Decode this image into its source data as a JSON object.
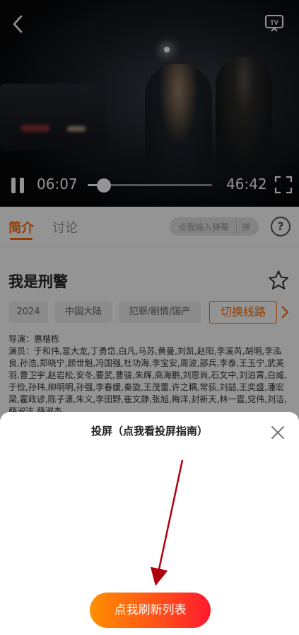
{
  "player": {
    "current_time": "06:07",
    "total_time": "46:42",
    "progress_fraction": 0.13,
    "icons": {
      "back": "chevron-left-icon",
      "cast_tv": "tv-icon",
      "pause": "pause-icon",
      "fullscreen": "fullscreen-icon"
    }
  },
  "tabs": {
    "intro_label": "简介",
    "discuss_label": "讨论",
    "danmu_placeholder": "点我输入弹幕",
    "danmu_send": "弹",
    "help_symbol": "?"
  },
  "show": {
    "title": "我是刑警",
    "tags": [
      "2024",
      "中国大陆",
      "犯罪/剧情/国产"
    ],
    "switch_line_label": "切换线路",
    "director": "导演：惠楷栋",
    "cast": "演员：于和伟,富大龙,丁勇岱,白凡,马苏,黄曼,刘凯,赵阳,李溪芮,胡明,李泓良,孙浩,郑晓宁,颜世魁,冯国强,杜功海,李宝安,周波,邵兵,李泰,王玉宁,武芙羽,曹卫宇,赵岩松,安冬,要武,曹骏,朱辉,高海鹏,刘恩尚,石文中,刘泊霄,白威,于俭,孙玮,柳明明,孙强,李春媛,秦旋,王茂蕾,许之耦,常荻,刘喆,王奕盛,潘宏梁,霍政谚,陈子潇,朱义,李田野,崔文静,张旭,梅洋,封新天,林一霆,党伟,刘洁,薛淑洁,薛淑杰"
  },
  "cast_sheet": {
    "title": "投屏（点我看投屏指南）",
    "refresh_label": "点我刷新列表",
    "close_icon": "close-icon",
    "accent": "#ff6a00",
    "hint_arrow_color": "#b00010"
  }
}
